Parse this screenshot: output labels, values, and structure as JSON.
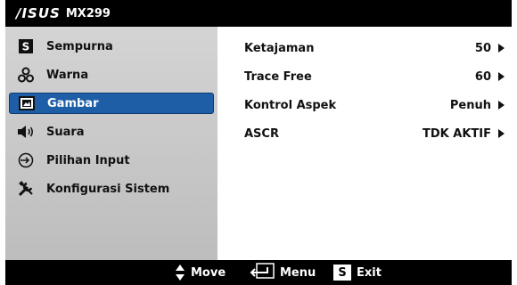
{
  "header": {
    "brand": "/ISUS",
    "model": "MX299"
  },
  "sidebar": {
    "items": [
      {
        "label": "Sempurna",
        "icon": "splendid-s-icon"
      },
      {
        "label": "Warna",
        "icon": "color-nodes-icon"
      },
      {
        "label": "Gambar",
        "icon": "image-icon",
        "selected": true
      },
      {
        "label": "Suara",
        "icon": "speaker-icon"
      },
      {
        "label": "Pilihan Input",
        "icon": "input-icon"
      },
      {
        "label": "Konfigurasi Sistem",
        "icon": "tools-icon"
      }
    ]
  },
  "settings": {
    "rows": [
      {
        "label": "Ketajaman",
        "value": "50"
      },
      {
        "label": "Trace Free",
        "value": "60"
      },
      {
        "label": "Kontrol Aspek",
        "value": "Penuh"
      },
      {
        "label": "ASCR",
        "value": "TDK AKTIF"
      }
    ]
  },
  "footer": {
    "move": "Move",
    "menu": "Menu",
    "exit": "Exit",
    "exit_key": "S"
  },
  "colors": {
    "selected": "#1e5ea6",
    "bar": "#000000"
  }
}
